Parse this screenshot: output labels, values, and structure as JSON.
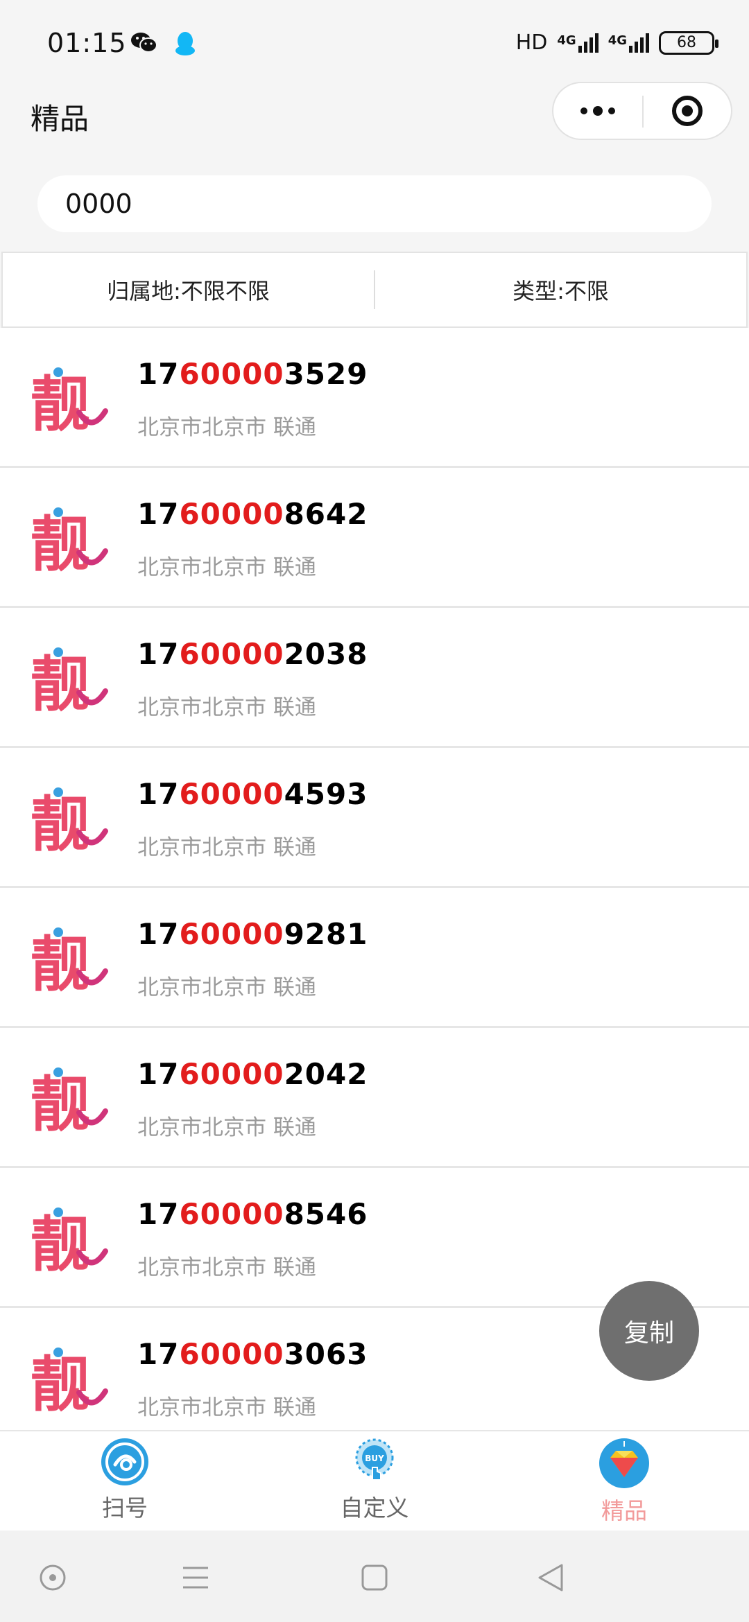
{
  "status_bar": {
    "time": "01:15",
    "hd_label": "HD",
    "network_1": "4G",
    "network_2": "4G",
    "battery": "68",
    "app_icons": [
      "wechat-icon",
      "qq-icon"
    ]
  },
  "nav": {
    "title": "精品",
    "icons": [
      "more-icon",
      "close-target-icon"
    ]
  },
  "search": {
    "value": "0000"
  },
  "filters": {
    "location_label": "归属地:不限不限",
    "type_label": "类型:不限"
  },
  "list": [
    {
      "prefix": "17",
      "highlight": "60000",
      "suffix": "3529",
      "location": "北京市北京市 联通"
    },
    {
      "prefix": "17",
      "highlight": "60000",
      "suffix": "8642",
      "location": "北京市北京市 联通"
    },
    {
      "prefix": "17",
      "highlight": "60000",
      "suffix": "2038",
      "location": "北京市北京市 联通"
    },
    {
      "prefix": "17",
      "highlight": "60000",
      "suffix": "4593",
      "location": "北京市北京市 联通"
    },
    {
      "prefix": "17",
      "highlight": "60000",
      "suffix": "9281",
      "location": "北京市北京市 联通"
    },
    {
      "prefix": "17",
      "highlight": "60000",
      "suffix": "2042",
      "location": "北京市北京市 联通"
    },
    {
      "prefix": "17",
      "highlight": "60000",
      "suffix": "8546",
      "location": "北京市北京市 联通"
    },
    {
      "prefix": "17",
      "highlight": "60000",
      "suffix": "3063",
      "location": "北京市北京市 联通"
    }
  ],
  "fab": {
    "label": "复制"
  },
  "tabs": [
    {
      "label": "扫号",
      "icon": "scan-icon",
      "active": false
    },
    {
      "label": "自定义",
      "icon": "buy-icon",
      "active": false
    },
    {
      "label": "精品",
      "icon": "diamond-icon",
      "active": true
    }
  ],
  "colors": {
    "highlight": "#e21c1c",
    "active_tab": "#f29a9a",
    "logo_pink": "#e94b6b"
  }
}
